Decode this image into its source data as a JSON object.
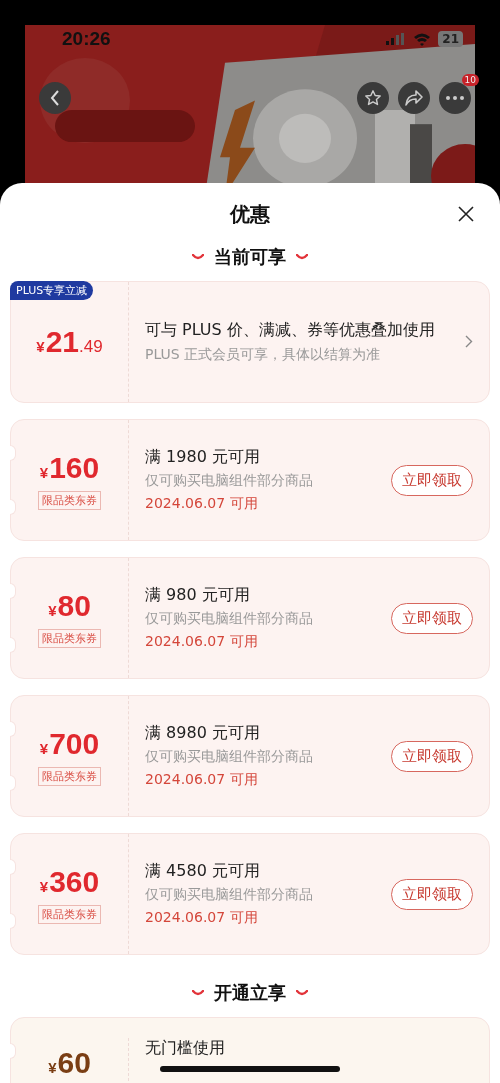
{
  "status_bar": {
    "time": "20:26",
    "battery": "21"
  },
  "nav": {
    "more_badge": "10"
  },
  "sheet": {
    "title": "优惠"
  },
  "sections": [
    {
      "title": "当前可享",
      "cards": [
        {
          "kind": "plus",
          "tag": "PLUS专享立减",
          "currency": "¥",
          "amount": "21",
          "decimal": ".49",
          "title": "可与 PLUS 价、满减、券等优惠叠加使用",
          "note": "PLUS 正式会员可享，具体以结算为准"
        },
        {
          "kind": "coupon",
          "currency": "¥",
          "amount": "160",
          "type": "限品类东券",
          "title": "满 1980 元可用",
          "scope": "仅可购买电脑组件部分商品",
          "date": "2024.06.07 可用",
          "action": "立即领取"
        },
        {
          "kind": "coupon",
          "currency": "¥",
          "amount": "80",
          "type": "限品类东券",
          "title": "满 980 元可用",
          "scope": "仅可购买电脑组件部分商品",
          "date": "2024.06.07 可用",
          "action": "立即领取"
        },
        {
          "kind": "coupon",
          "currency": "¥",
          "amount": "700",
          "type": "限品类东券",
          "title": "满 8980 元可用",
          "scope": "仅可购买电脑组件部分商品",
          "date": "2024.06.07 可用",
          "action": "立即领取"
        },
        {
          "kind": "coupon",
          "currency": "¥",
          "amount": "360",
          "type": "限品类东券",
          "title": "满 4580 元可用",
          "scope": "仅可购买电脑组件部分商品",
          "date": "2024.06.07 可用",
          "action": "立即领取"
        }
      ]
    },
    {
      "title": "开通立享",
      "cards": [
        {
          "kind": "member",
          "currency": "¥",
          "amount": "60",
          "title": "无门槛使用"
        }
      ]
    }
  ]
}
